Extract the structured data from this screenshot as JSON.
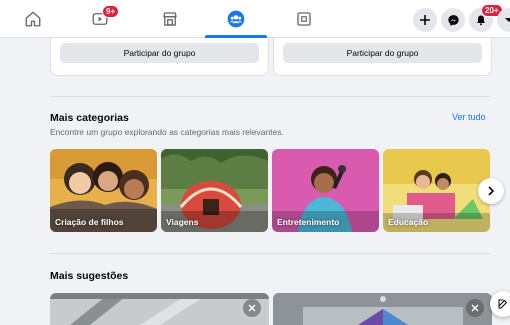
{
  "nav": {
    "watch_badge": "9+",
    "notifications_badge": "20+"
  },
  "join_cards": [
    {
      "button_label": "Participar do grupo"
    },
    {
      "button_label": "Participar do grupo"
    }
  ],
  "categories": {
    "title": "Mais categorias",
    "subtitle": "Encontre um grupo explorando as categorias mais relevantes.",
    "see_all": "Ver tudo",
    "items": [
      {
        "label": "Criação de filhos"
      },
      {
        "label": "Viagens"
      },
      {
        "label": "Entretenimento"
      },
      {
        "label": "Educação"
      }
    ]
  },
  "suggestions": {
    "title": "Mais sugestões"
  },
  "colors": {
    "accent": "#1877f2",
    "badge": "#e41e3f",
    "page_bg": "#f0f2f5"
  }
}
